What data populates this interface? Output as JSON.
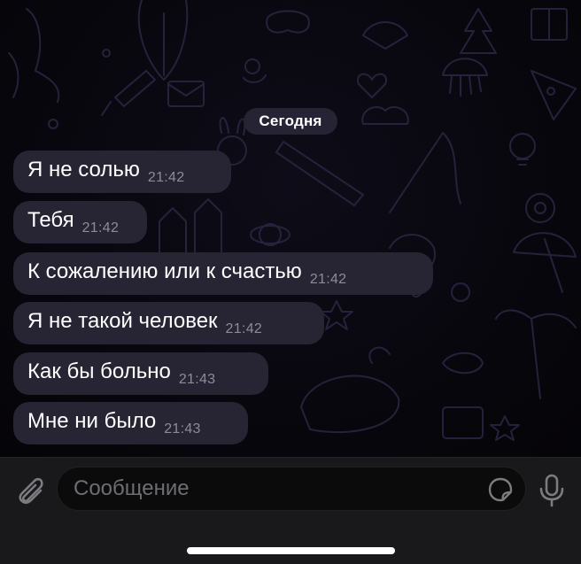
{
  "chat": {
    "date_label": "Сегодня",
    "messages": [
      {
        "text": "Я не солью",
        "time": "21:42"
      },
      {
        "text": "Тебя",
        "time": "21:42"
      },
      {
        "text": "К сожалению или к счастью",
        "time": "21:42"
      },
      {
        "text": "Я не такой человек",
        "time": "21:42"
      },
      {
        "text": "Как бы больно",
        "time": "21:43"
      },
      {
        "text": "Мне ни было",
        "time": "21:43"
      }
    ]
  },
  "composer": {
    "placeholder": "Сообщение",
    "attach_icon": "paperclip-icon",
    "sticker_icon": "sticker-icon",
    "mic_icon": "microphone-icon"
  },
  "colors": {
    "background": "#07060b",
    "bubble": "#272434",
    "bubble_text": "#ffffff",
    "time_text": "#8e8b99",
    "bar": "#19191b",
    "placeholder_text": "#6e6d73"
  }
}
